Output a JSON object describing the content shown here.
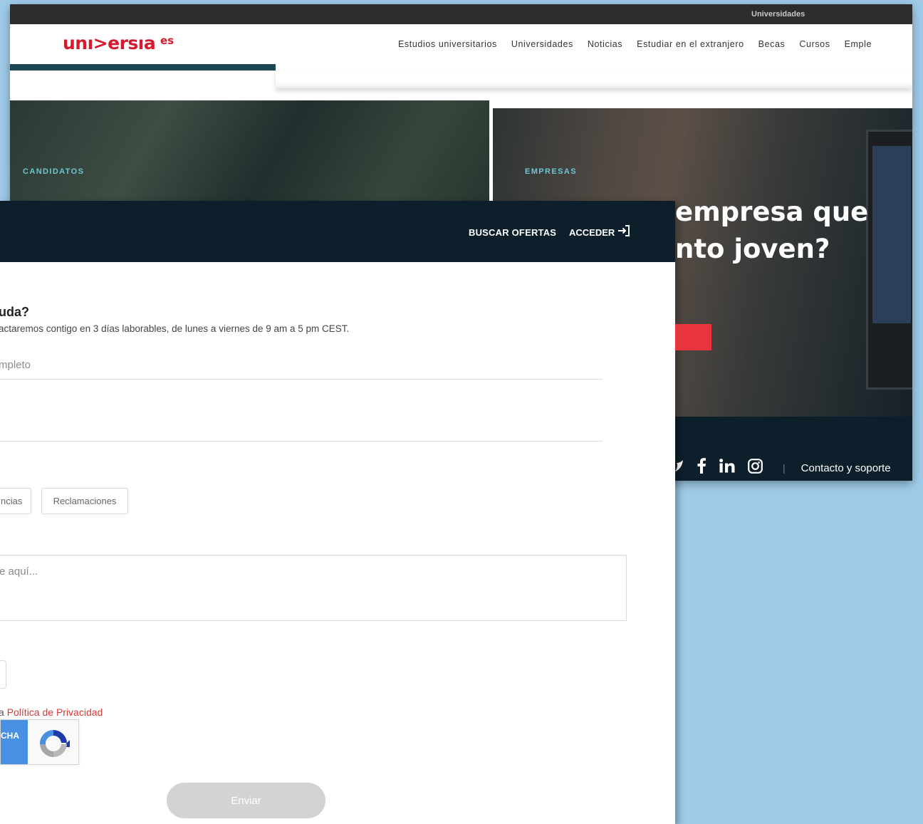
{
  "back_window": {
    "top_strip": {
      "link": "Universidades"
    },
    "logo": {
      "text": "unı>ersıa",
      "suffix": "es"
    },
    "nav": [
      "Estudios universitarios",
      "Universidades",
      "Noticias",
      "Estudiar en el extranjero",
      "Becas",
      "Cursos",
      "Emple"
    ],
    "hero_left": {
      "label": "CANDIDATOS"
    },
    "hero_right": {
      "label": "EMPRESAS",
      "headline": "empresa que\nnto joven?"
    },
    "footer": {
      "social_icons": [
        "twitter-icon",
        "facebook-icon",
        "linkedin-icon",
        "instagram-icon"
      ],
      "contact_link": "Contacto y soporte"
    }
  },
  "front_window": {
    "header": {
      "search_offers": "BUSCAR OFERTAS",
      "login": "ACCEDER"
    },
    "form": {
      "title": "uda?",
      "subtitle": "actaremos contigo en 3 días laborables, de lunes a viernes de 9 am a 5 pm CEST.",
      "name_placeholder": "mpleto",
      "chips": [
        "ncias",
        "Reclamaciones"
      ],
      "message_placeholder": "e aquí...",
      "privacy_prefix": "a",
      "privacy_link": "Política de Privacidad",
      "recaptcha_label": "CHA",
      "submit_label": "Enviar"
    }
  },
  "colors": {
    "brand_red": "#d7192d",
    "dark_navy": "#0d1f2b",
    "teal_label": "#6ec6d3",
    "cta_red": "#e8343d",
    "desktop_bg": "#9fcbe8"
  }
}
